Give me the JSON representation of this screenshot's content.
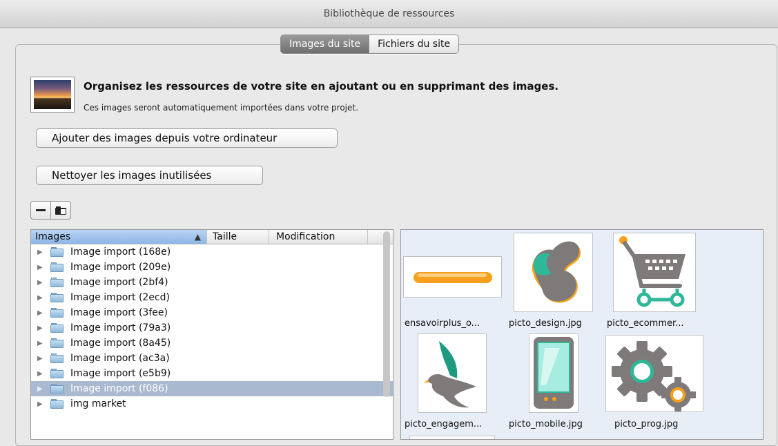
{
  "window": {
    "title": "Bibliothèque de ressources"
  },
  "tabs": [
    {
      "label": "Images du site",
      "active": true
    },
    {
      "label": "Fichiers du site",
      "active": false
    }
  ],
  "header": {
    "headline": "Organisez les ressources de votre site en ajoutant ou en supprimant des images.",
    "subline": "Ces images seront automatiquement importées dans votre projet."
  },
  "buttons": {
    "add": "Ajouter des images depuis votre ordinateur",
    "clean": "Nettoyer les images inutilisées"
  },
  "toolbar": {
    "remove_icon": "minus-icon",
    "new_folder_icon": "new-folder-icon"
  },
  "list": {
    "columns": {
      "images": "Images",
      "size": "Taille",
      "modified": "Modification"
    },
    "sort_indicator": "▲",
    "rows": [
      {
        "label": "Image import (168e)"
      },
      {
        "label": "Image import (209e)"
      },
      {
        "label": "Image import (2bf4)"
      },
      {
        "label": "Image import (2ecd)"
      },
      {
        "label": "Image import (3fee)"
      },
      {
        "label": "Image import (79a3)"
      },
      {
        "label": "Image import (8a45)"
      },
      {
        "label": "Image import (ac3a)"
      },
      {
        "label": "Image import (e5b9)"
      },
      {
        "label": "Image import (f086)",
        "selected": true
      },
      {
        "label": "img market"
      }
    ]
  },
  "thumbnails": [
    {
      "caption": "ensavoirplus_o...",
      "icon": "orange-bar-icon"
    },
    {
      "caption": "picto_design.jpg",
      "icon": "design-blob-icon"
    },
    {
      "caption": "picto_ecommer...",
      "icon": "shopping-cart-icon"
    },
    {
      "caption": "picto_engagem...",
      "icon": "bird-icon"
    },
    {
      "caption": "picto_mobile.jpg",
      "icon": "mobile-phone-icon"
    },
    {
      "caption": "picto_prog.jpg",
      "icon": "gears-icon"
    }
  ],
  "colors": {
    "accent_orange": "#f6a01e",
    "accent_teal": "#2fb79a",
    "icon_gray": "#7f7a7a",
    "selection": "#a9b9d0",
    "header_selected": "#8eb6e6"
  }
}
